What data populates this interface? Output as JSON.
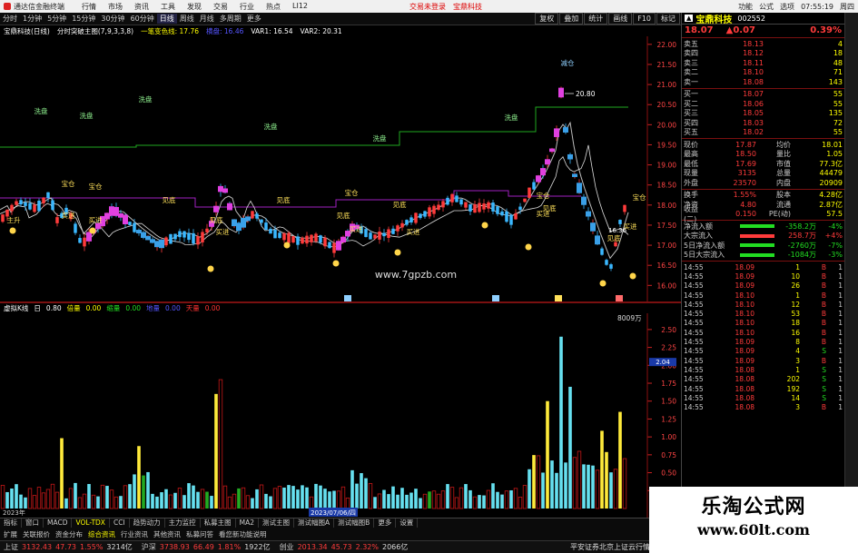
{
  "app": {
    "title": "通达信金融终端",
    "menu": [
      "行情",
      "市场",
      "资讯",
      "工具",
      "发现",
      "交易",
      "行业",
      "热点",
      "LI12"
    ],
    "promo": [
      "交易未登录",
      "宝鼎科技"
    ],
    "right": [
      "功能",
      "公式",
      "选项",
      "07:55:19",
      "周四"
    ]
  },
  "toolbar": {
    "timeframes": [
      "分时",
      "1分钟",
      "5分钟",
      "15分钟",
      "30分钟",
      "60分钟",
      "日线",
      "周线",
      "月线",
      "多周期",
      "更多"
    ],
    "active": "日线",
    "functions": [
      "复权",
      "叠加",
      "统计",
      "画线",
      "F10",
      "标记"
    ]
  },
  "info": {
    "stock": "宝鼎科技(日线)",
    "indicator": "分时突破主图(7,9,3,3,8)",
    "line1": "一笔变色线: 17.76",
    "line2": "横盘: 16.46",
    "var1": "VAR1: 16.54",
    "var2": "VAR2: 20.31"
  },
  "main": {
    "axis": [
      "22.00",
      "21.50",
      "21.00",
      "20.50",
      "20.00",
      "19.50",
      "19.00",
      "18.50",
      "18.00",
      "17.50",
      "17.00",
      "16.50",
      "16.00"
    ],
    "peak": "20.80",
    "low": "16.36",
    "watermark": "www.7gpzb.com",
    "labels": [
      "减仓",
      "洗盘",
      "宝仓",
      "见底",
      "买进",
      "主升"
    ]
  },
  "vol": {
    "header": [
      "虚拟K线",
      "日",
      "0.80",
      "倍量",
      "0.00",
      "缩量",
      "0.00",
      "地量",
      "0.00",
      "天量",
      "0.00"
    ],
    "maxlabel": "8009万",
    "axis": [
      "2.50",
      "2.25",
      "2.00",
      "1.75",
      "1.50",
      "1.25",
      "1.00",
      "0.75",
      "0.50",
      "0.25"
    ],
    "marker": "2.04",
    "date": "2023/07/06/四",
    "year": "2023年"
  },
  "tabs": [
    "指标",
    "窗口",
    "MACD",
    "VOL-TDX",
    "CCI",
    "趋势动力",
    "主力监控",
    "私募主图",
    "MA2",
    "测试主图",
    "测试幅图A",
    "测试幅图B",
    "更多",
    "设置"
  ],
  "tabs2": [
    "扩展",
    "关联报价",
    "资金分布",
    "综合资讯",
    "行业资讯",
    "其他资讯",
    "私募问答",
    "看您新功能说明"
  ],
  "status": {
    "items": [
      {
        "n": "上证",
        "v": "3132.43",
        "c": "47.73",
        "p": "1.55%",
        "a": "3214亿"
      },
      {
        "n": "沪深",
        "v": "3738.93",
        "c": "66.49",
        "p": "1.81%",
        "a": "1922亿"
      },
      {
        "n": "创业",
        "v": "2013.34",
        "c": "45.73",
        "p": "2.32%",
        "a": "2066亿"
      }
    ],
    "right": "平安证券北京上证云行情"
  },
  "quote": {
    "name": "宝鼎科技",
    "code": "002552",
    "price": "18.07",
    "change": "0.07",
    "pct": "0.39%",
    "asks": [
      {
        "l": "卖五",
        "p": "18.13",
        "v": "4"
      },
      {
        "l": "卖四",
        "p": "18.12",
        "v": "18"
      },
      {
        "l": "卖三",
        "p": "18.11",
        "v": "48"
      },
      {
        "l": "卖二",
        "p": "18.10",
        "v": "71"
      },
      {
        "l": "卖一",
        "p": "18.08",
        "v": "143"
      }
    ],
    "bids": [
      {
        "l": "买一",
        "p": "18.07",
        "v": "55"
      },
      {
        "l": "买二",
        "p": "18.06",
        "v": "55"
      },
      {
        "l": "买三",
        "p": "18.05",
        "v": "135"
      },
      {
        "l": "买四",
        "p": "18.03",
        "v": "72"
      },
      {
        "l": "买五",
        "p": "18.02",
        "v": "55"
      }
    ],
    "stats": [
      [
        "现价",
        "17.87",
        "均价",
        "18.01"
      ],
      [
        "最高",
        "18.50",
        "量比",
        "1.05"
      ],
      [
        "最低",
        "17.69",
        "市值",
        "77.3亿"
      ],
      [
        "现量",
        "3135",
        "总量",
        "44479"
      ],
      [
        "外盘",
        "23570",
        "内盘",
        "20909"
      ]
    ],
    "stats2": [
      [
        "换手",
        "1.55%",
        "股本",
        "4.28亿"
      ],
      [
        "净资",
        "4.80",
        "流通",
        "2.87亿"
      ],
      [
        "收益(二)",
        "0.150",
        "PE(动)",
        "57.5"
      ]
    ],
    "flows": [
      {
        "l": "净流入额",
        "v": "-358.2万",
        "p": "-4%"
      },
      {
        "l": "大宗流入",
        "v": "258.7万",
        "p": "+4%"
      },
      {
        "l": "5日净流入额",
        "v": "-2760万",
        "p": "-7%"
      },
      {
        "l": "5日大宗流入",
        "v": "-1084万",
        "p": "-3%"
      }
    ],
    "ticks": [
      [
        "14:55",
        "18.09",
        "1",
        "B",
        "1"
      ],
      [
        "14:55",
        "18.09",
        "10",
        "B",
        "1"
      ],
      [
        "14:55",
        "18.09",
        "26",
        "B",
        "1"
      ],
      [
        "14:55",
        "18.10",
        "1",
        "B",
        "1"
      ],
      [
        "14:55",
        "18.10",
        "12",
        "B",
        "1"
      ],
      [
        "14:55",
        "18.10",
        "53",
        "B",
        "1"
      ],
      [
        "14:55",
        "18.10",
        "18",
        "B",
        "1"
      ],
      [
        "14:55",
        "18.10",
        "16",
        "B",
        "1"
      ],
      [
        "14:55",
        "18.09",
        "8",
        "B",
        "1"
      ],
      [
        "14:55",
        "18.09",
        "4",
        "S",
        "1"
      ],
      [
        "14:55",
        "18.09",
        "3",
        "B",
        "1"
      ],
      [
        "14:55",
        "18.08",
        "1",
        "S",
        "1"
      ],
      [
        "14:55",
        "18.08",
        "202",
        "S",
        "1"
      ],
      [
        "14:55",
        "18.08",
        "192",
        "S",
        "1"
      ],
      [
        "14:55",
        "18.08",
        "14",
        "S",
        "1"
      ],
      [
        "14:55",
        "18.08",
        "3",
        "B",
        "1"
      ]
    ]
  },
  "watermark2": {
    "a": "乐淘公式网",
    "b": "www.60lt.com"
  },
  "colors": {
    "up": "#ff3b3b",
    "down": "#22dd22",
    "cyan": "#66e0f0",
    "yellow": "#ffea3b"
  }
}
